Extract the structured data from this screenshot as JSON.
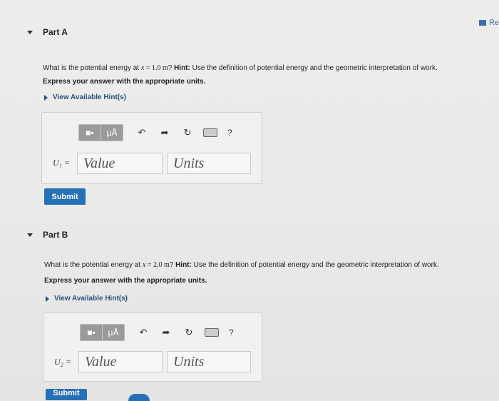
{
  "header": {
    "link_label": "Re"
  },
  "partA": {
    "title": "Part A",
    "q_prefix": "What is the potential energy at ",
    "q_var": "x",
    "q_eq": " = 1.0 ",
    "q_unit": "m",
    "q_mid": "? ",
    "hint_label": "Hint:",
    "q_rest": " Use the definition of potential energy and the geometric interpretation of work.",
    "express": "Express your answer with the appropriate units.",
    "hints_link": "View Available Hint(s)",
    "var_label": "U₁ =",
    "value_placeholder": "Value",
    "units_placeholder": "Units",
    "submit": "Submit"
  },
  "partB": {
    "title": "Part B",
    "q_prefix": "What is the potential energy at ",
    "q_var": "x",
    "q_eq": " = 2.0 ",
    "q_unit": "m",
    "q_mid": "? ",
    "hint_label": "Hint:",
    "q_rest": " Use the definition of potential energy and the geometric interpretation of work.",
    "express": "Express your answer with the appropriate units.",
    "hints_link": "View Available Hint(s)",
    "var_label": "U₂ =",
    "value_placeholder": "Value",
    "units_placeholder": "Units",
    "submit": "Submit"
  },
  "toolbar": {
    "templates_glyph": "■▪",
    "symbols_glyph": "μÅ",
    "undo_glyph": "↶",
    "redo_glyph": "➦",
    "reset_glyph": "↻",
    "help_glyph": "?"
  },
  "colors": {
    "accent": "#2670b5",
    "link": "#2a4f86"
  },
  "icons": [
    "templates-icon",
    "symbols-icon",
    "undo-icon",
    "redo-icon",
    "reset-icon",
    "keyboard-icon",
    "help-icon"
  ]
}
